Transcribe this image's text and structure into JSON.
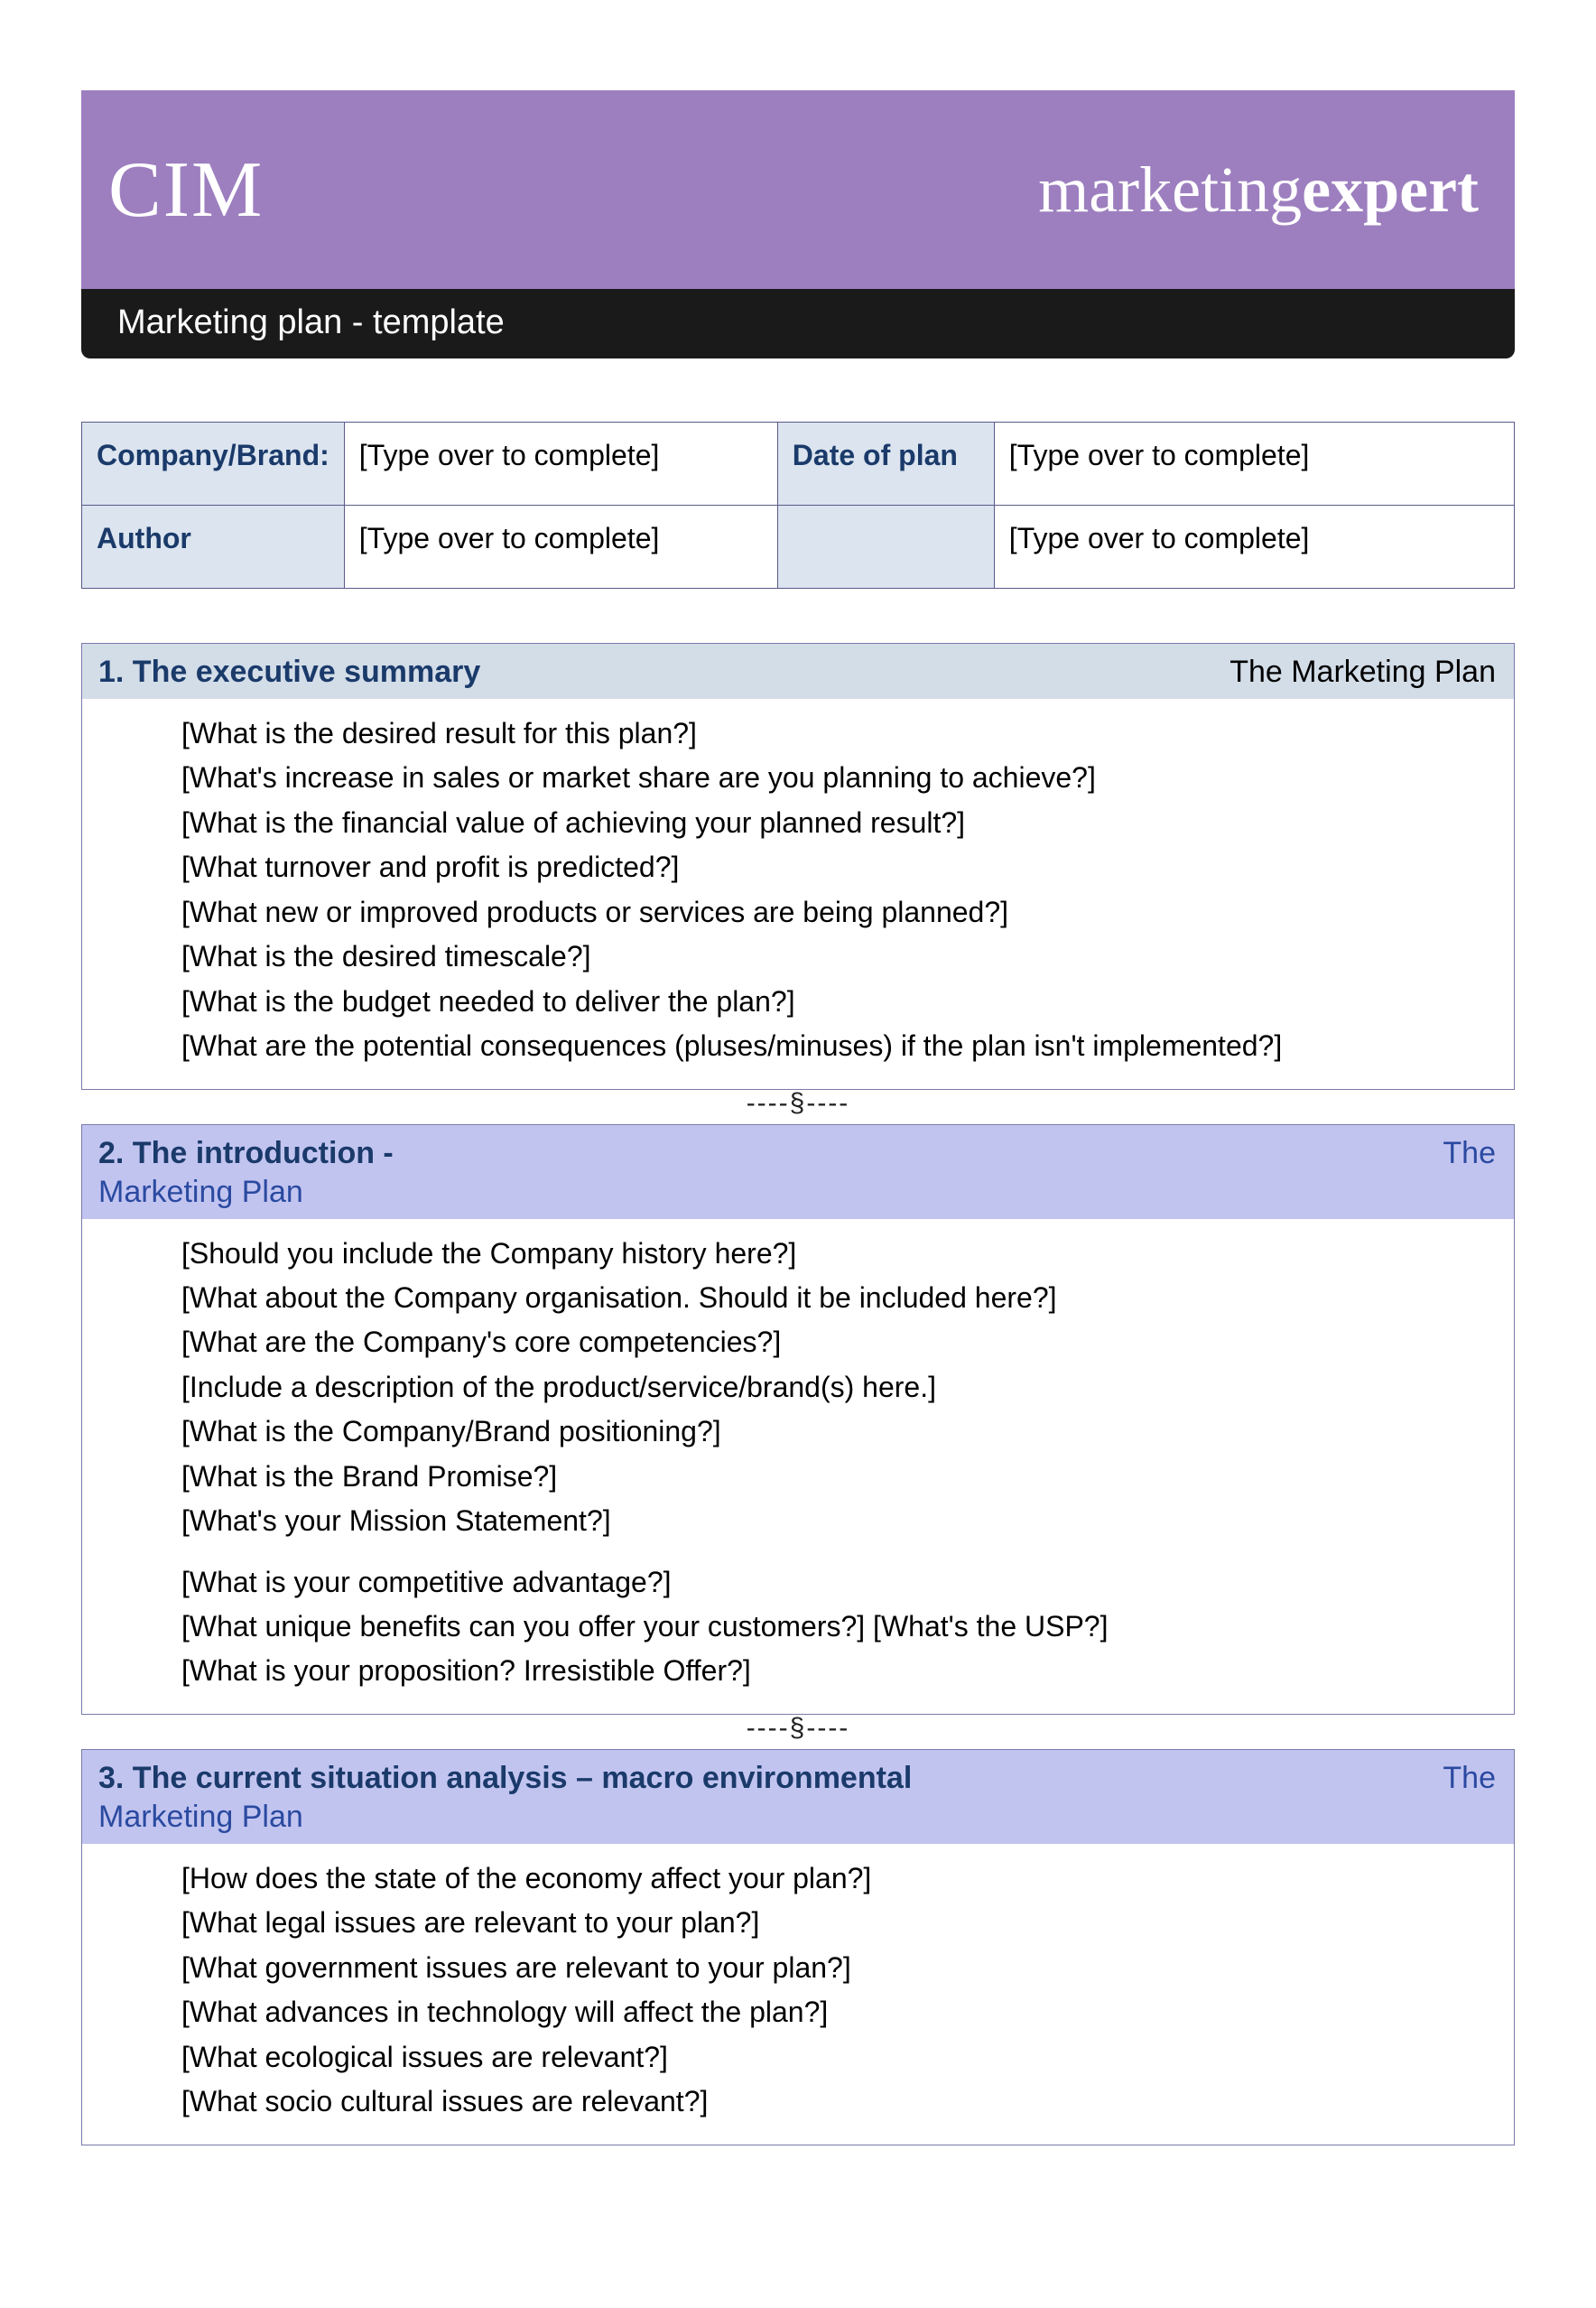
{
  "banner": {
    "logo_text": "CIM",
    "brand_prefix": "marketing",
    "brand_bold": "expert"
  },
  "subbar": {
    "title": "Marketing plan - template"
  },
  "info": {
    "row1": {
      "label1": "Company/Brand:",
      "val1": "[Type over to complete]",
      "label2": "Date of plan",
      "val2": "[Type over to complete]"
    },
    "row2": {
      "label1": "Author",
      "val1": "[Type over to complete]",
      "label2": "",
      "val2": "[Type over to complete]"
    }
  },
  "separator": "----§----",
  "sections": [
    {
      "header_bg": "bg-blue",
      "num_title": "1.  The executive summary",
      "right_label": "The Marketing Plan",
      "trail": "",
      "questions": [
        "[What is the desired result for this plan?]",
        "[What's increase in sales or market share are you planning to achieve?]",
        "[What is the financial value of achieving your planned result?]",
        "[What turnover and profit is predicted?]",
        "[What new or improved products or services are being planned?]",
        "[What is the desired timescale?]",
        "[What is the budget needed to deliver the plan?]",
        "[What are the potential consequences (pluses/minuses) if the plan isn't implemented?]"
      ]
    },
    {
      "header_bg": "bg-lilac",
      "num_title": "2.  The introduction -",
      "right_label": "The",
      "trail": "Marketing Plan",
      "questions_a": [
        "[Should you include the Company history here?]",
        "[What about the Company organisation.  Should it be included here?]",
        "[What are the Company's core competencies?]",
        "[Include a description of the product/service/brand(s) here.]",
        "[What is the Company/Brand positioning?]",
        "[What is the Brand Promise?]",
        "[What's your Mission Statement?]"
      ],
      "questions_b": [
        "[What is your competitive advantage?]",
        "[What unique benefits can you offer your customers?]  [What's the USP?]",
        "[What is your proposition? Irresistible Offer?]"
      ]
    },
    {
      "header_bg": "bg-lilac",
      "num_title": "3. The current situation analysis – macro environmental",
      "right_label": "The",
      "trail": "Marketing Plan",
      "questions": [
        "[How does the state of the economy affect your plan?]",
        "[What legal issues are relevant to your plan?]",
        "[What government issues are relevant to your plan?]",
        "[What advances in technology will affect the plan?]",
        "[What ecological issues are relevant?]",
        "[What socio cultural issues are relevant?]"
      ]
    }
  ]
}
